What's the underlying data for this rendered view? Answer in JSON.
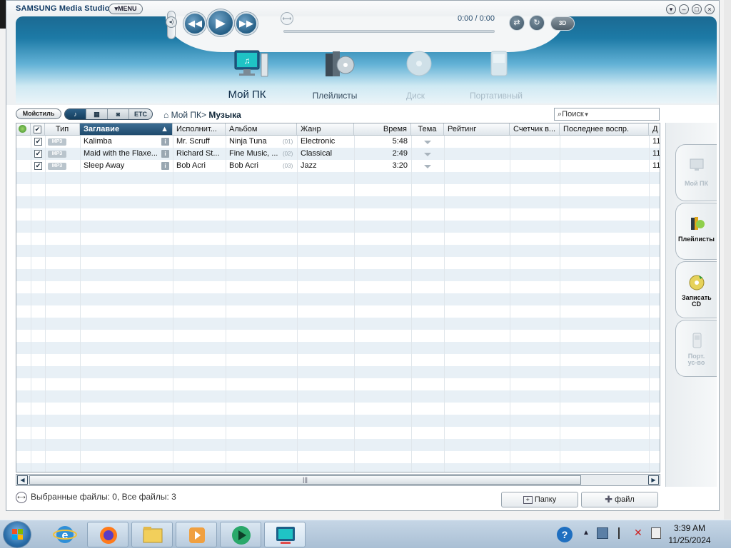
{
  "app": {
    "brand": "SAMSUNG Media Studio",
    "menu_label": "MENU",
    "timecode": "0:00 / 0:00",
    "btn_3d": "3D",
    "win_controls": [
      "▾",
      "–",
      "□",
      "×"
    ]
  },
  "nav": {
    "items": [
      {
        "label": "Мой ПК",
        "state": "active"
      },
      {
        "label": "Плейлисты",
        "state": "normal"
      },
      {
        "label": "Диск",
        "state": "disabled"
      },
      {
        "label": "Портативный",
        "state": "disabled"
      }
    ]
  },
  "toolbar": {
    "mystyle": "Мойстиль",
    "filters": [
      "♪",
      "▦",
      "◙",
      "ETC"
    ],
    "breadcrumb_root": "Мой ПК>",
    "breadcrumb_current": "Музыка",
    "search_placeholder": "Поиск"
  },
  "table": {
    "columns": [
      "Тип",
      "Заглавие",
      "Исполнит...",
      "Альбом",
      "Жанр",
      "Время",
      "Тема",
      "Рейтинг",
      "Счетчик в...",
      "Последнее воспр.",
      "Д"
    ],
    "rows": [
      {
        "type": "MP3",
        "title": "Kalimba",
        "artist": "Mr. Scruff",
        "album": "Ninja Tuna",
        "track": "(01)",
        "genre": "Electronic",
        "time": "5:48",
        "extra": "11"
      },
      {
        "type": "MP3",
        "title": "Maid with the Flaxe...",
        "artist": "Richard St...",
        "album": "Fine Music, ...",
        "track": "(02)",
        "genre": "Classical",
        "time": "2:49",
        "extra": "11"
      },
      {
        "type": "MP3",
        "title": "Sleep Away",
        "artist": "Bob Acri",
        "album": "Bob Acri",
        "track": "(03)",
        "genre": "Jazz",
        "time": "3:20",
        "extra": "11"
      }
    ]
  },
  "status": {
    "text": "Выбранные файлы: 0, Все файлы: 3",
    "folder_btn": "Папку",
    "file_btn": "файл"
  },
  "side_tabs": [
    {
      "label": "Мой ПК",
      "state": "disabled"
    },
    {
      "label": "Плейлисты",
      "state": "normal"
    },
    {
      "label": "Записать CD",
      "state": "normal"
    },
    {
      "label": "Порт. ус-во",
      "state": "disabled"
    }
  ],
  "taskbar": {
    "time": "3:39 AM",
    "date": "11/25/2024"
  },
  "colors": {
    "accent": "#1d7aa6",
    "header_sorted": "#1f4a6c",
    "stripe": "#e8f0f6"
  }
}
